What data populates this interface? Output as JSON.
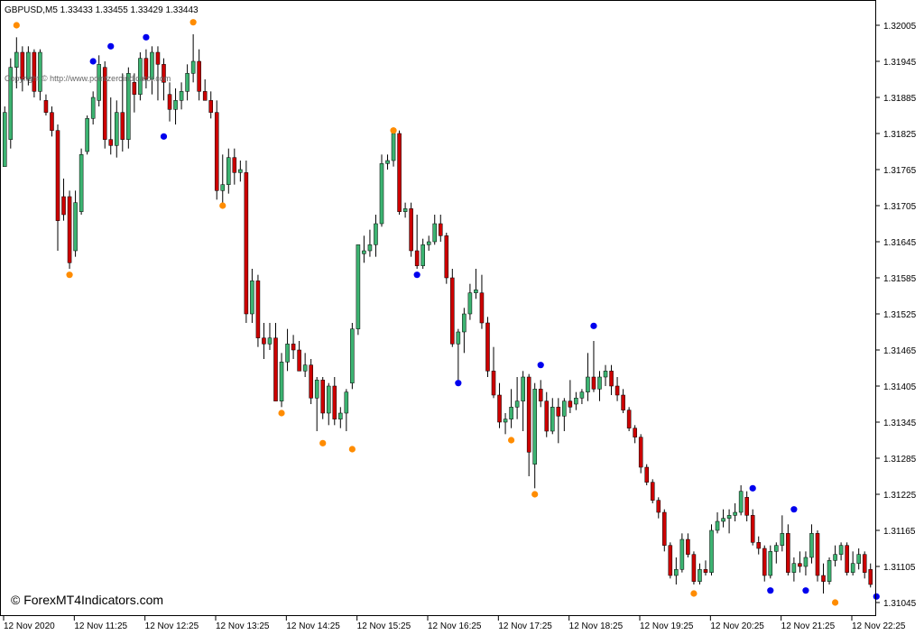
{
  "chart_data": {
    "type": "candlestick",
    "symbol_header": "GBPUSD,M5  1.33433 1.33455 1.33429 1.33443",
    "watermark": "Copyright © http://www.pointzeroindicator.com",
    "brand": "© ForexMT4Indicators.com",
    "y_ticks": [
      "1.32005",
      "1.31945",
      "1.31885",
      "1.31825",
      "1.31765",
      "1.31705",
      "1.31645",
      "1.31585",
      "1.31525",
      "1.31465",
      "1.31405",
      "1.31345",
      "1.31285",
      "1.31225",
      "1.31165",
      "1.31105",
      "1.31045"
    ],
    "x_ticks": [
      "12 Nov 2020",
      "12 Nov 11:25",
      "12 Nov 12:25",
      "12 Nov 13:25",
      "12 Nov 14:25",
      "12 Nov 15:25",
      "12 Nov 16:25",
      "12 Nov 17:25",
      "12 Nov 18:25",
      "12 Nov 19:25",
      "12 Nov 20:25",
      "12 Nov 21:25",
      "12 Nov 22:25"
    ],
    "ylim": [
      1.3103,
      1.32025
    ],
    "colors": {
      "bull": "#3cb371",
      "bear": "#cc0000",
      "up_dot": "#0000ee",
      "down_dot": "#ff8c00",
      "wick": "#000000",
      "grid": "#000000"
    },
    "candles": [
      {
        "o": 1.3177,
        "h": 1.3187,
        "l": 1.3177,
        "c": 1.3186
      },
      {
        "o": 1.31815,
        "h": 1.3195,
        "l": 1.318,
        "c": 1.31935
      },
      {
        "o": 1.31935,
        "h": 1.31985,
        "l": 1.319,
        "c": 1.3196
      },
      {
        "o": 1.3196,
        "h": 1.3197,
        "l": 1.31895,
        "c": 1.31915
      },
      {
        "o": 1.31915,
        "h": 1.3197,
        "l": 1.31905,
        "c": 1.3196
      },
      {
        "o": 1.3196,
        "h": 1.31965,
        "l": 1.31885,
        "c": 1.31895
      },
      {
        "o": 1.31895,
        "h": 1.31965,
        "l": 1.3188,
        "c": 1.3196
      },
      {
        "o": 1.3188,
        "h": 1.3189,
        "l": 1.31855,
        "c": 1.3186
      },
      {
        "o": 1.3186,
        "h": 1.3187,
        "l": 1.3182,
        "c": 1.3183
      },
      {
        "o": 1.3183,
        "h": 1.3184,
        "l": 1.3163,
        "c": 1.3168
      },
      {
        "o": 1.3172,
        "h": 1.3175,
        "l": 1.3168,
        "c": 1.3169
      },
      {
        "o": 1.3172,
        "h": 1.3173,
        "l": 1.316,
        "c": 1.3161
      },
      {
        "o": 1.3163,
        "h": 1.3173,
        "l": 1.3162,
        "c": 1.3171
      },
      {
        "o": 1.31695,
        "h": 1.318,
        "l": 1.3169,
        "c": 1.3179
      },
      {
        "o": 1.31795,
        "h": 1.31855,
        "l": 1.3179,
        "c": 1.3185
      },
      {
        "o": 1.3185,
        "h": 1.31895,
        "l": 1.3184,
        "c": 1.31885
      },
      {
        "o": 1.3188,
        "h": 1.31955,
        "l": 1.3187,
        "c": 1.3194
      },
      {
        "o": 1.31935,
        "h": 1.31945,
        "l": 1.318,
        "c": 1.31815
      },
      {
        "o": 1.31815,
        "h": 1.31885,
        "l": 1.3179,
        "c": 1.31805
      },
      {
        "o": 1.31805,
        "h": 1.3188,
        "l": 1.31785,
        "c": 1.3186
      },
      {
        "o": 1.3186,
        "h": 1.31925,
        "l": 1.31795,
        "c": 1.31815
      },
      {
        "o": 1.31815,
        "h": 1.31935,
        "l": 1.318,
        "c": 1.31925
      },
      {
        "o": 1.3191,
        "h": 1.31925,
        "l": 1.3186,
        "c": 1.3189
      },
      {
        "o": 1.3189,
        "h": 1.3196,
        "l": 1.3188,
        "c": 1.3195
      },
      {
        "o": 1.3195,
        "h": 1.31965,
        "l": 1.319,
        "c": 1.31915
      },
      {
        "o": 1.31915,
        "h": 1.3197,
        "l": 1.3189,
        "c": 1.3196
      },
      {
        "o": 1.3196,
        "h": 1.3197,
        "l": 1.3188,
        "c": 1.3194
      },
      {
        "o": 1.3194,
        "h": 1.3195,
        "l": 1.3188,
        "c": 1.3191
      },
      {
        "o": 1.3189,
        "h": 1.3191,
        "l": 1.31845,
        "c": 1.31865
      },
      {
        "o": 1.31865,
        "h": 1.319,
        "l": 1.3184,
        "c": 1.3188
      },
      {
        "o": 1.3188,
        "h": 1.3191,
        "l": 1.31865,
        "c": 1.31895
      },
      {
        "o": 1.31895,
        "h": 1.3194,
        "l": 1.3188,
        "c": 1.31925
      },
      {
        "o": 1.31925,
        "h": 1.3199,
        "l": 1.3191,
        "c": 1.31945
      },
      {
        "o": 1.31945,
        "h": 1.31965,
        "l": 1.3188,
        "c": 1.31895
      },
      {
        "o": 1.31895,
        "h": 1.31915,
        "l": 1.3188,
        "c": 1.3188
      },
      {
        "o": 1.3188,
        "h": 1.31895,
        "l": 1.3185,
        "c": 1.3186
      },
      {
        "o": 1.3186,
        "h": 1.3188,
        "l": 1.31715,
        "c": 1.3173
      },
      {
        "o": 1.3173,
        "h": 1.3179,
        "l": 1.3171,
        "c": 1.3174
      },
      {
        "o": 1.3174,
        "h": 1.318,
        "l": 1.31725,
        "c": 1.31785
      },
      {
        "o": 1.31785,
        "h": 1.318,
        "l": 1.3174,
        "c": 1.3176
      },
      {
        "o": 1.3176,
        "h": 1.3178,
        "l": 1.31745,
        "c": 1.31765
      },
      {
        "o": 1.3176,
        "h": 1.3178,
        "l": 1.3151,
        "c": 1.31525
      },
      {
        "o": 1.31525,
        "h": 1.316,
        "l": 1.3151,
        "c": 1.3158
      },
      {
        "o": 1.3158,
        "h": 1.3159,
        "l": 1.3147,
        "c": 1.31485
      },
      {
        "o": 1.31485,
        "h": 1.3151,
        "l": 1.3145,
        "c": 1.31475
      },
      {
        "o": 1.31475,
        "h": 1.3151,
        "l": 1.31465,
        "c": 1.31485
      },
      {
        "o": 1.31485,
        "h": 1.3151,
        "l": 1.3138,
        "c": 1.3138
      },
      {
        "o": 1.3138,
        "h": 1.3146,
        "l": 1.3137,
        "c": 1.31445
      },
      {
        "o": 1.31445,
        "h": 1.315,
        "l": 1.3143,
        "c": 1.31475
      },
      {
        "o": 1.31475,
        "h": 1.3149,
        "l": 1.3145,
        "c": 1.31465
      },
      {
        "o": 1.31465,
        "h": 1.3148,
        "l": 1.3143,
        "c": 1.3143
      },
      {
        "o": 1.3143,
        "h": 1.3146,
        "l": 1.3142,
        "c": 1.3144
      },
      {
        "o": 1.3144,
        "h": 1.3145,
        "l": 1.31375,
        "c": 1.31385
      },
      {
        "o": 1.31385,
        "h": 1.3142,
        "l": 1.3133,
        "c": 1.31415
      },
      {
        "o": 1.31415,
        "h": 1.3142,
        "l": 1.3135,
        "c": 1.3136
      },
      {
        "o": 1.3136,
        "h": 1.3141,
        "l": 1.3134,
        "c": 1.31405
      },
      {
        "o": 1.31405,
        "h": 1.3142,
        "l": 1.3134,
        "c": 1.3135
      },
      {
        "o": 1.3135,
        "h": 1.3137,
        "l": 1.31335,
        "c": 1.3136
      },
      {
        "o": 1.3136,
        "h": 1.314,
        "l": 1.3133,
        "c": 1.31395
      },
      {
        "o": 1.3141,
        "h": 1.3151,
        "l": 1.314,
        "c": 1.315
      },
      {
        "o": 1.315,
        "h": 1.3164,
        "l": 1.3149,
        "c": 1.3164
      },
      {
        "o": 1.31625,
        "h": 1.31655,
        "l": 1.3161,
        "c": 1.3163
      },
      {
        "o": 1.3163,
        "h": 1.31665,
        "l": 1.3162,
        "c": 1.3164
      },
      {
        "o": 1.3164,
        "h": 1.3169,
        "l": 1.3162,
        "c": 1.31675
      },
      {
        "o": 1.31675,
        "h": 1.3179,
        "l": 1.3167,
        "c": 1.31775
      },
      {
        "o": 1.31775,
        "h": 1.3179,
        "l": 1.31765,
        "c": 1.3178
      },
      {
        "o": 1.3178,
        "h": 1.31835,
        "l": 1.3177,
        "c": 1.31825
      },
      {
        "o": 1.31825,
        "h": 1.3183,
        "l": 1.3169,
        "c": 1.31695
      },
      {
        "o": 1.31695,
        "h": 1.3171,
        "l": 1.31685,
        "c": 1.317
      },
      {
        "o": 1.317,
        "h": 1.3171,
        "l": 1.3162,
        "c": 1.3163
      },
      {
        "o": 1.3163,
        "h": 1.3169,
        "l": 1.316,
        "c": 1.31605
      },
      {
        "o": 1.31605,
        "h": 1.3165,
        "l": 1.316,
        "c": 1.3164
      },
      {
        "o": 1.3164,
        "h": 1.31655,
        "l": 1.3163,
        "c": 1.31645
      },
      {
        "o": 1.31645,
        "h": 1.3169,
        "l": 1.3164,
        "c": 1.31675
      },
      {
        "o": 1.31675,
        "h": 1.3169,
        "l": 1.31645,
        "c": 1.31655
      },
      {
        "o": 1.31655,
        "h": 1.3166,
        "l": 1.31575,
        "c": 1.31585
      },
      {
        "o": 1.31585,
        "h": 1.316,
        "l": 1.3147,
        "c": 1.31475
      },
      {
        "o": 1.31475,
        "h": 1.315,
        "l": 1.31415,
        "c": 1.31495
      },
      {
        "o": 1.31495,
        "h": 1.31535,
        "l": 1.3146,
        "c": 1.31525
      },
      {
        "o": 1.31525,
        "h": 1.31575,
        "l": 1.31515,
        "c": 1.3156
      },
      {
        "o": 1.3156,
        "h": 1.316,
        "l": 1.3155,
        "c": 1.31565
      },
      {
        "o": 1.3156,
        "h": 1.3159,
        "l": 1.315,
        "c": 1.3151
      },
      {
        "o": 1.3151,
        "h": 1.3152,
        "l": 1.3142,
        "c": 1.3143
      },
      {
        "o": 1.3143,
        "h": 1.3147,
        "l": 1.31385,
        "c": 1.3139
      },
      {
        "o": 1.3139,
        "h": 1.3141,
        "l": 1.31335,
        "c": 1.31345
      },
      {
        "o": 1.31345,
        "h": 1.3136,
        "l": 1.31325,
        "c": 1.3135
      },
      {
        "o": 1.3135,
        "h": 1.314,
        "l": 1.31335,
        "c": 1.3137
      },
      {
        "o": 1.3137,
        "h": 1.3142,
        "l": 1.3135,
        "c": 1.3138
      },
      {
        "o": 1.3138,
        "h": 1.3143,
        "l": 1.3133,
        "c": 1.3142
      },
      {
        "o": 1.3142,
        "h": 1.31425,
        "l": 1.31255,
        "c": 1.31295
      },
      {
        "o": 1.31275,
        "h": 1.3141,
        "l": 1.31235,
        "c": 1.314
      },
      {
        "o": 1.314,
        "h": 1.31415,
        "l": 1.3137,
        "c": 1.3138
      },
      {
        "o": 1.3138,
        "h": 1.31395,
        "l": 1.3132,
        "c": 1.3133
      },
      {
        "o": 1.3133,
        "h": 1.31385,
        "l": 1.31325,
        "c": 1.3137
      },
      {
        "o": 1.3137,
        "h": 1.31385,
        "l": 1.3131,
        "c": 1.31355
      },
      {
        "o": 1.31355,
        "h": 1.31385,
        "l": 1.3133,
        "c": 1.3138
      },
      {
        "o": 1.3138,
        "h": 1.31415,
        "l": 1.3136,
        "c": 1.3137
      },
      {
        "o": 1.31375,
        "h": 1.31395,
        "l": 1.31365,
        "c": 1.31385
      },
      {
        "o": 1.31385,
        "h": 1.314,
        "l": 1.31375,
        "c": 1.31395
      },
      {
        "o": 1.31395,
        "h": 1.3146,
        "l": 1.3138,
        "c": 1.3142
      },
      {
        "o": 1.3142,
        "h": 1.3148,
        "l": 1.31395,
        "c": 1.314
      },
      {
        "o": 1.314,
        "h": 1.3143,
        "l": 1.3138,
        "c": 1.3142
      },
      {
        "o": 1.3142,
        "h": 1.3144,
        "l": 1.31405,
        "c": 1.3143
      },
      {
        "o": 1.3143,
        "h": 1.3144,
        "l": 1.3139,
        "c": 1.31405
      },
      {
        "o": 1.31405,
        "h": 1.3142,
        "l": 1.3138,
        "c": 1.3139
      },
      {
        "o": 1.3139,
        "h": 1.314,
        "l": 1.3136,
        "c": 1.31365
      },
      {
        "o": 1.31365,
        "h": 1.3137,
        "l": 1.3133,
        "c": 1.31335
      },
      {
        "o": 1.31335,
        "h": 1.3134,
        "l": 1.3131,
        "c": 1.3132
      },
      {
        "o": 1.3132,
        "h": 1.31325,
        "l": 1.3126,
        "c": 1.3127
      },
      {
        "o": 1.3127,
        "h": 1.31275,
        "l": 1.3124,
        "c": 1.31245
      },
      {
        "o": 1.31245,
        "h": 1.3125,
        "l": 1.3121,
        "c": 1.31215
      },
      {
        "o": 1.31215,
        "h": 1.3122,
        "l": 1.31185,
        "c": 1.31195
      },
      {
        "o": 1.31195,
        "h": 1.312,
        "l": 1.3113,
        "c": 1.3114
      },
      {
        "o": 1.3114,
        "h": 1.31145,
        "l": 1.31085,
        "c": 1.3109
      },
      {
        "o": 1.3109,
        "h": 1.3112,
        "l": 1.31075,
        "c": 1.311
      },
      {
        "o": 1.311,
        "h": 1.3116,
        "l": 1.31095,
        "c": 1.3115
      },
      {
        "o": 1.3115,
        "h": 1.3116,
        "l": 1.3112,
        "c": 1.31125
      },
      {
        "o": 1.31125,
        "h": 1.3113,
        "l": 1.31075,
        "c": 1.3108
      },
      {
        "o": 1.3108,
        "h": 1.3111,
        "l": 1.31075,
        "c": 1.311
      },
      {
        "o": 1.311,
        "h": 1.31115,
        "l": 1.3109,
        "c": 1.31095
      },
      {
        "o": 1.31095,
        "h": 1.31175,
        "l": 1.3109,
        "c": 1.31165
      },
      {
        "o": 1.31165,
        "h": 1.31195,
        "l": 1.3116,
        "c": 1.3118
      },
      {
        "o": 1.3118,
        "h": 1.312,
        "l": 1.3117,
        "c": 1.31185
      },
      {
        "o": 1.31185,
        "h": 1.312,
        "l": 1.3116,
        "c": 1.3119
      },
      {
        "o": 1.3119,
        "h": 1.3121,
        "l": 1.3118,
        "c": 1.31195
      },
      {
        "o": 1.31195,
        "h": 1.3124,
        "l": 1.3119,
        "c": 1.3123
      },
      {
        "o": 1.3122,
        "h": 1.3123,
        "l": 1.3118,
        "c": 1.3119
      },
      {
        "o": 1.3119,
        "h": 1.312,
        "l": 1.3114,
        "c": 1.31145
      },
      {
        "o": 1.31145,
        "h": 1.31155,
        "l": 1.31125,
        "c": 1.31135
      },
      {
        "o": 1.31135,
        "h": 1.3114,
        "l": 1.3108,
        "c": 1.3109
      },
      {
        "o": 1.3109,
        "h": 1.3114,
        "l": 1.31085,
        "c": 1.3113
      },
      {
        "o": 1.3113,
        "h": 1.31145,
        "l": 1.3111,
        "c": 1.3114
      },
      {
        "o": 1.3114,
        "h": 1.3119,
        "l": 1.3113,
        "c": 1.3116
      },
      {
        "o": 1.3116,
        "h": 1.31175,
        "l": 1.3109,
        "c": 1.31095
      },
      {
        "o": 1.31095,
        "h": 1.3112,
        "l": 1.3108,
        "c": 1.3111
      },
      {
        "o": 1.3111,
        "h": 1.3113,
        "l": 1.31095,
        "c": 1.31105
      },
      {
        "o": 1.31105,
        "h": 1.3113,
        "l": 1.3109,
        "c": 1.3112
      },
      {
        "o": 1.3112,
        "h": 1.31175,
        "l": 1.3111,
        "c": 1.3116
      },
      {
        "o": 1.3116,
        "h": 1.31165,
        "l": 1.3108,
        "c": 1.3109
      },
      {
        "o": 1.3109,
        "h": 1.3111,
        "l": 1.3106,
        "c": 1.3108
      },
      {
        "o": 1.3108,
        "h": 1.3112,
        "l": 1.31075,
        "c": 1.31115
      },
      {
        "o": 1.31115,
        "h": 1.3114,
        "l": 1.31105,
        "c": 1.31125
      },
      {
        "o": 1.31125,
        "h": 1.31145,
        "l": 1.31115,
        "c": 1.3114
      },
      {
        "o": 1.3114,
        "h": 1.31145,
        "l": 1.3109,
        "c": 1.31095
      },
      {
        "o": 1.31095,
        "h": 1.3113,
        "l": 1.3109,
        "c": 1.3111
      },
      {
        "o": 1.3111,
        "h": 1.31135,
        "l": 1.311,
        "c": 1.31125
      },
      {
        "o": 1.31125,
        "h": 1.3113,
        "l": 1.31085,
        "c": 1.31095
      },
      {
        "o": 1.311,
        "h": 1.3111,
        "l": 1.3107,
        "c": 1.31075
      }
    ],
    "signals": [
      {
        "i": 2,
        "type": "down",
        "price": 1.32005
      },
      {
        "i": 15,
        "type": "up",
        "price": 1.31945
      },
      {
        "i": 18,
        "type": "up",
        "price": 1.3197
      },
      {
        "i": 24,
        "type": "up",
        "price": 1.31985
      },
      {
        "i": 27,
        "type": "up",
        "price": 1.3182
      },
      {
        "i": 32,
        "type": "down",
        "price": 1.3201
      },
      {
        "i": 37,
        "type": "down",
        "price": 1.31705
      },
      {
        "i": 11,
        "type": "down",
        "price": 1.3159
      },
      {
        "i": 47,
        "type": "down",
        "price": 1.3136
      },
      {
        "i": 54,
        "type": "down",
        "price": 1.3131
      },
      {
        "i": 59,
        "type": "down",
        "price": 1.313
      },
      {
        "i": 66,
        "type": "down",
        "price": 1.3183
      },
      {
        "i": 70,
        "type": "up",
        "price": 1.3159
      },
      {
        "i": 77,
        "type": "up",
        "price": 1.3141
      },
      {
        "i": 86,
        "type": "down",
        "price": 1.31315
      },
      {
        "i": 90,
        "type": "down",
        "price": 1.31225
      },
      {
        "i": 91,
        "type": "up",
        "price": 1.3144
      },
      {
        "i": 100,
        "type": "up",
        "price": 1.31505
      },
      {
        "i": 117,
        "type": "down",
        "price": 1.3106
      },
      {
        "i": 127,
        "type": "up",
        "price": 1.31235
      },
      {
        "i": 130,
        "type": "up",
        "price": 1.31065
      },
      {
        "i": 134,
        "type": "up",
        "price": 1.312
      },
      {
        "i": 136,
        "type": "up",
        "price": 1.31065
      },
      {
        "i": 141,
        "type": "down",
        "price": 1.31045
      },
      {
        "i": 148,
        "type": "up",
        "price": 1.31055
      }
    ]
  }
}
